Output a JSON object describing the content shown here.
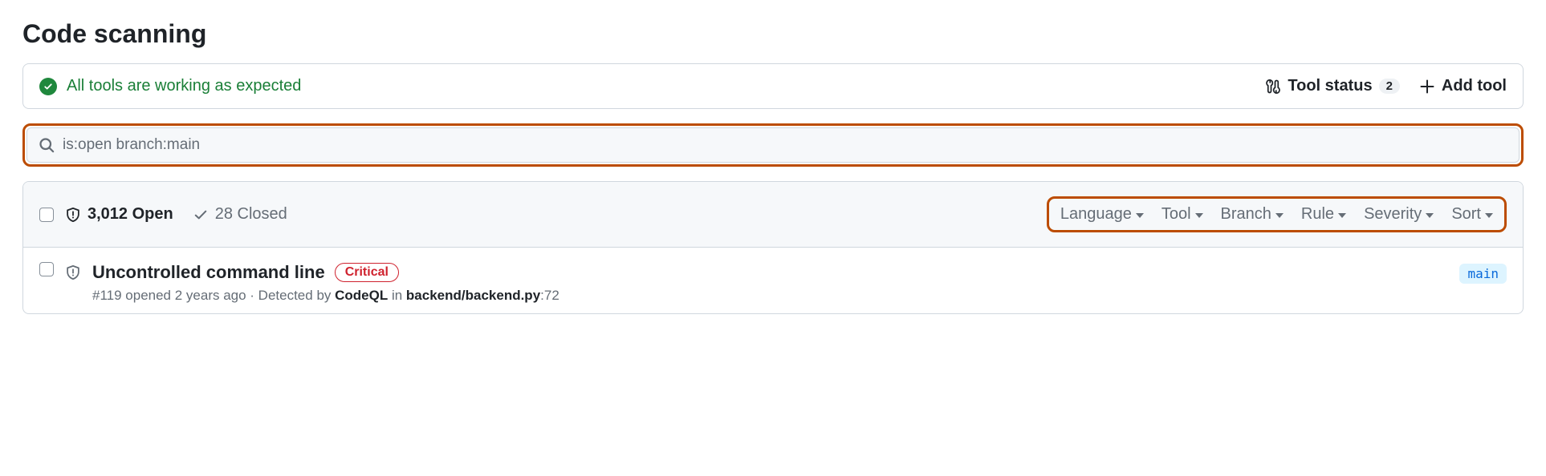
{
  "page_title": "Code scanning",
  "status_bar": {
    "message": "All tools are working as expected",
    "tool_status_label": "Tool status",
    "tool_status_count": "2",
    "add_tool_label": "Add tool"
  },
  "search": {
    "value": "is:open branch:main"
  },
  "counts": {
    "open_label": "3,012 Open",
    "closed_label": "28 Closed"
  },
  "filters": {
    "language": "Language",
    "tool": "Tool",
    "branch": "Branch",
    "rule": "Rule",
    "severity": "Severity",
    "sort": "Sort"
  },
  "alerts": [
    {
      "title": "Uncontrolled command line",
      "severity": "Critical",
      "meta_prefix": "#119 opened 2 years ago · Detected by ",
      "detected_by": "CodeQL",
      "meta_mid": " in ",
      "file": "backend/backend.py",
      "line_suffix": ":72",
      "branch": "main"
    }
  ]
}
